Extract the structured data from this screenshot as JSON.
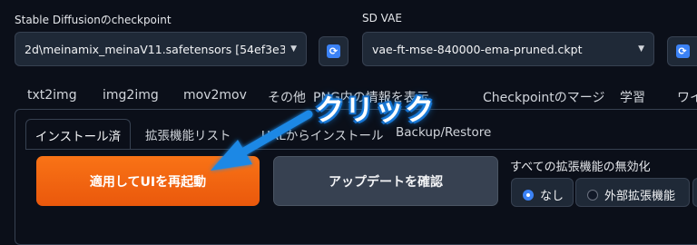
{
  "settings": {
    "checkpoint_label": "Stable Diffusionのcheckpoint",
    "checkpoint_value": "2d\\meinamix_meinaV11.safetensors [54ef3e36]",
    "vae_label": "SD VAE",
    "vae_value": "vae-ft-mse-840000-ema-pruned.ckpt"
  },
  "main_tabs": [
    "txt2img",
    "img2img",
    "mov2mov",
    "その他",
    "PNG内の情報を表示",
    "Checkpointのマージ",
    "学習",
    "ワイ"
  ],
  "extension_tabs": [
    "インストール済",
    "拡張機能リスト",
    "URLからインストール",
    "Backup/Restore"
  ],
  "buttons": {
    "apply": "適用してUIを再起動",
    "check_updates": "アップデートを確認"
  },
  "disable_all": {
    "label": "すべての拡張機能の無効化",
    "options": [
      "なし",
      "外部拡張機能"
    ],
    "selected": "なし"
  },
  "annotation": {
    "text": "クリック",
    "color": "#1e88e5"
  },
  "icons": {
    "refresh": "refresh-icon",
    "caret": "chevron-down-icon"
  }
}
